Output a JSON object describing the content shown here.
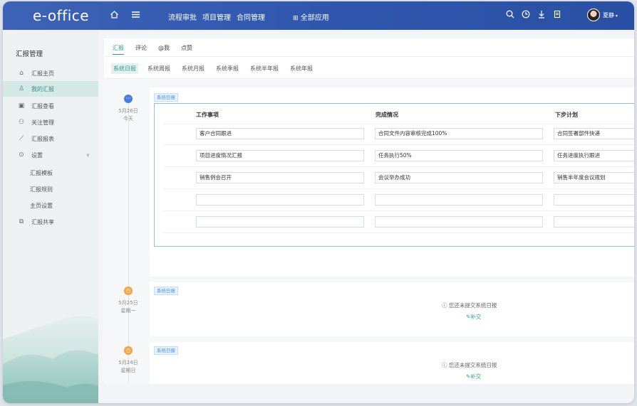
{
  "topbar": {
    "logo": "e-office",
    "home_icon": "home-icon",
    "menu_icon": "hamburger-icon",
    "nav": [
      "流程审批",
      "项目管理",
      "合同管理"
    ],
    "all_apps_label": "全部应用",
    "all_apps_icon": "grid-icon",
    "right_icons": [
      "search-icon",
      "clock-icon",
      "download-icon",
      "document-icon"
    ],
    "username": "夏静"
  },
  "sidebar": {
    "title": "汇报管理",
    "items": [
      {
        "label": "汇报主页",
        "icon": "home-icon"
      },
      {
        "label": "我的汇报",
        "icon": "user-icon",
        "active": true
      },
      {
        "label": "汇报查看",
        "icon": "view-icon"
      },
      {
        "label": "关注管理",
        "icon": "users-icon"
      },
      {
        "label": "汇报报表",
        "icon": "chart-icon"
      },
      {
        "label": "设置",
        "icon": "settings-icon"
      }
    ],
    "sub_items": [
      "汇报模板",
      "汇报规则",
      "主页设置"
    ],
    "share_item": {
      "label": "汇报共享",
      "icon": "share-icon"
    }
  },
  "tabs_primary": [
    "汇报",
    "评论",
    "@我",
    "点赞"
  ],
  "tabs_secondary": [
    "系统日报",
    "系统周报",
    "系统月报",
    "系统季报",
    "系统半年报",
    "系统年报"
  ],
  "timeline": [
    {
      "date": "5月26日",
      "day": "今天",
      "tag": "系统日报",
      "columns": [
        "工作事项",
        "完成情况",
        "下步计划"
      ],
      "rows": [
        [
          "客户合同跟进",
          "合同文件内容审核完成100%",
          "合同签署部件快递"
        ],
        [
          "项目进度情况汇报",
          "任务执行50%",
          "任务进度执行跟进"
        ],
        [
          "销售例会召开",
          "会议举办成功",
          "销售半年度会议规划"
        ],
        [
          "",
          "",
          ""
        ],
        [
          "",
          "",
          ""
        ]
      ]
    },
    {
      "date": "5月25日",
      "day": "星期一",
      "tag": "系统日报",
      "notice": "您还未提交系统日报",
      "supply": "补交"
    },
    {
      "date": "5月24日",
      "day": "星期日",
      "tag": "系统日报",
      "notice": "您还未提交系统日报",
      "supply": "补交"
    }
  ]
}
